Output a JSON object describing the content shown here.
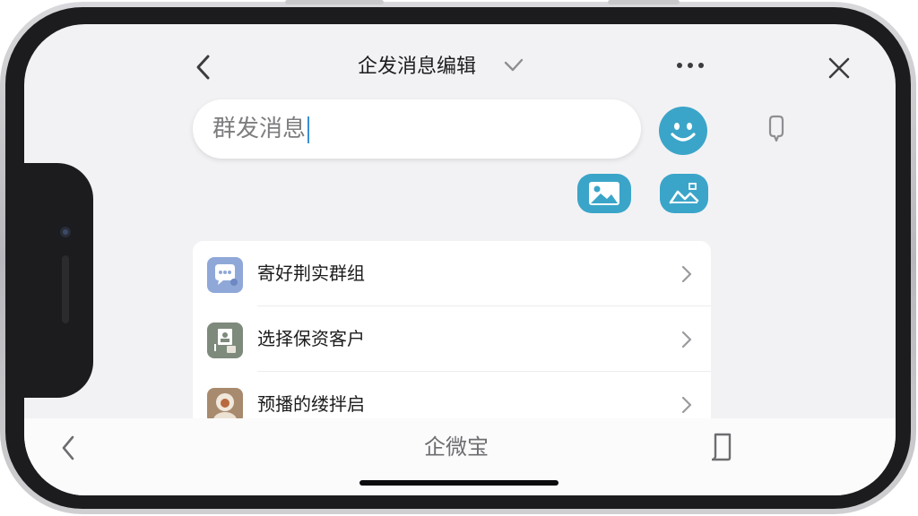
{
  "header": {
    "title": "企发消息编辑",
    "back_icon": "chevron-left-icon",
    "check_icon": "check-icon",
    "more_icon": "more-horizontal-icon",
    "close_icon": "close-icon"
  },
  "compose": {
    "input_value": "群发消息",
    "mic_icon": "microphone-icon",
    "emoji_icon": "smiley-icon",
    "image_icon": "image-icon",
    "chart_icon": "chart-image-icon",
    "accent_color": "#3ba5c9"
  },
  "list": {
    "items": [
      {
        "label": "寄好荆实群组",
        "icon": "chat-group-icon"
      },
      {
        "label": "选择保资客户",
        "icon": "customer-select-icon"
      },
      {
        "label": "预播的缕拌启",
        "icon": "avatar-icon"
      }
    ]
  },
  "bottom_bar": {
    "title": "企微宝",
    "back_icon": "chevron-left-icon",
    "doc_icon": "document-icon"
  }
}
